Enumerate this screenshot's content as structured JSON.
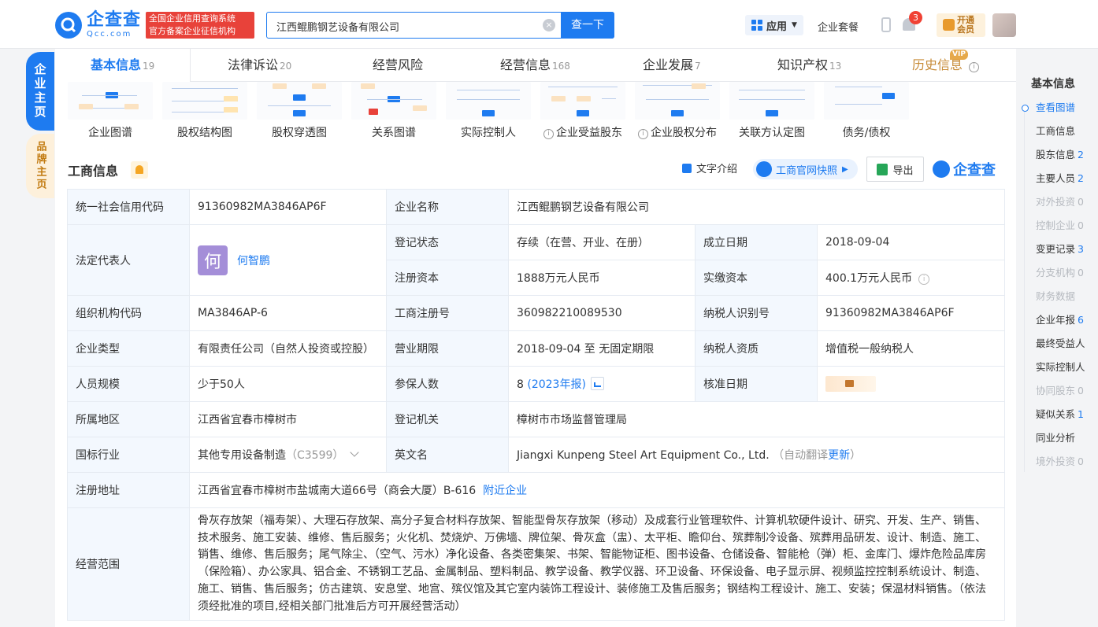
{
  "header": {
    "logo_cn": "企查查",
    "logo_en": "Qcc.com",
    "badge_line1": "全国企业信用查询系统",
    "badge_line2": "官方备案企业征信机构",
    "search_value": "江西鲲鹏钢艺设备有限公司",
    "search_button": "查一下",
    "apps_label": "应用",
    "package_label": "企业套餐",
    "notification_count": "3",
    "vip_line1": "开通",
    "vip_line2": "会员"
  },
  "side_tabs": {
    "company_home": "企业主页",
    "brand_home": "品牌主页"
  },
  "tabs": [
    {
      "label": "基本信息",
      "count": "19"
    },
    {
      "label": "法律诉讼",
      "count": "20"
    },
    {
      "label": "经营风险",
      "count": ""
    },
    {
      "label": "经营信息",
      "count": "168"
    },
    {
      "label": "企业发展",
      "count": "7"
    },
    {
      "label": "知识产权",
      "count": "13"
    },
    {
      "label": "历史信息",
      "count": ""
    }
  ],
  "vip_tag": "VIP",
  "graphs": [
    "企业图谱",
    "股权结构图",
    "股权穿透图",
    "关系图谱",
    "实际控制人",
    "企业受益股东",
    "企业股权分布",
    "关联方认定图",
    "债务/债权"
  ],
  "section": {
    "title": "工商信息",
    "text_intro": "文字介绍",
    "snapshot": "工商官网快照",
    "export": "导出",
    "logo": "企查查"
  },
  "info": {
    "credit_code_k": "统一社会信用代码",
    "credit_code_v": "91360982MA3846AP6F",
    "name_k": "企业名称",
    "name_v": "江西鲲鹏钢艺设备有限公司",
    "legal_rep_k": "法定代表人",
    "legal_rep_avatar": "何",
    "legal_rep_v": "何智鹏",
    "status_k": "登记状态",
    "status_v": "存续（在营、开业、在册）",
    "established_k": "成立日期",
    "established_v": "2018-09-04",
    "reg_capital_k": "注册资本",
    "reg_capital_v": "1888万元人民币",
    "paid_capital_k": "实缴资本",
    "paid_capital_v": "400.1万元人民币",
    "org_code_k": "组织机构代码",
    "org_code_v": "MA3846AP-6",
    "reg_no_k": "工商注册号",
    "reg_no_v": "360982210089530",
    "taxpayer_id_k": "纳税人识别号",
    "taxpayer_id_v": "91360982MA3846AP6F",
    "type_k": "企业类型",
    "type_v": "有限责任公司（自然人投资或控股）",
    "term_k": "营业期限",
    "term_v": "2018-09-04 至 无固定期限",
    "taxpayer_qual_k": "纳税人资质",
    "taxpayer_qual_v": "增值税一般纳税人",
    "staff_k": "人员规模",
    "staff_v": "少于50人",
    "insured_k": "参保人数",
    "insured_v": "8",
    "insured_report": "(2023年报)",
    "approval_k": "核准日期",
    "region_k": "所属地区",
    "region_v": "江西省宜春市樟树市",
    "authority_k": "登记机关",
    "authority_v": "樟树市市场监督管理局",
    "industry_k": "国标行业",
    "industry_v": "其他专用设备制造",
    "industry_code": "（C3599）",
    "english_k": "英文名",
    "english_v": "Jiangxi Kunpeng Steel Art Equipment Co., Ltd.",
    "english_note": "（自动翻译",
    "english_update": "更新",
    "english_close": "）",
    "address_k": "注册地址",
    "address_v": "江西省宜春市樟树市盐城南大道66号（商会大厦）B-616",
    "nearby": "附近企业",
    "scope_k": "经营范围",
    "scope_v": "骨灰存放架（福寿架）、大理石存放架、高分子复合材料存放架、智能型骨灰存放架（移动）及成套行业管理软件、计算机软硬件设计、研究、开发、生产、销售、技术服务、施工安装、维修、售后服务；火化机、焚烧炉、万佛墙、牌位架、骨灰盒（盅）、太平柜、瞻仰台、殡葬制冷设备、殡葬用品研发、设计、制造、施工、销售、维修、售后服务；尾气除尘、（空气、污水）净化设备、各类密集架、书架、智能物证柜、图书设备、仓储设备、智能枪（弹）柜、金库门、爆炸危险品库房（保险箱）、办公家具、铝合金、不锈钢工艺品、金属制品、塑料制品、教学设备、教学仪器、环卫设备、环保设备、电子显示屏、视频监控控制系统设计、制造、施工、销售、售后服务；仿古建筑、安息堂、地宫、殡仪馆及其它室内装饰工程设计、装修施工及售后服务；钢结构工程设计、施工、安装；保温材料销售。（依法须经批准的项目,经相关部门批准后方可开展经营活动）"
  },
  "right_nav": {
    "title": "基本信息",
    "items": [
      {
        "label": "查看图谱",
        "count": ""
      },
      {
        "label": "工商信息",
        "count": ""
      },
      {
        "label": "股东信息",
        "count": "2"
      },
      {
        "label": "主要人员",
        "count": "2"
      },
      {
        "label": "对外投资",
        "count": "0"
      },
      {
        "label": "控制企业",
        "count": "0"
      },
      {
        "label": "变更记录",
        "count": "3"
      },
      {
        "label": "分支机构",
        "count": "0"
      },
      {
        "label": "财务数据",
        "count": ""
      },
      {
        "label": "企业年报",
        "count": "6"
      },
      {
        "label": "最终受益人",
        "count": ""
      },
      {
        "label": "实际控制人",
        "count": ""
      },
      {
        "label": "协同股东",
        "count": "0"
      },
      {
        "label": "疑似关系",
        "count": "1"
      },
      {
        "label": "同业分析",
        "count": ""
      },
      {
        "label": "境外投资",
        "count": "0"
      }
    ]
  },
  "colors": {
    "brand": "#1e7bf0",
    "badge_red": "#e8423a",
    "vip_gold": "#c78b38"
  }
}
